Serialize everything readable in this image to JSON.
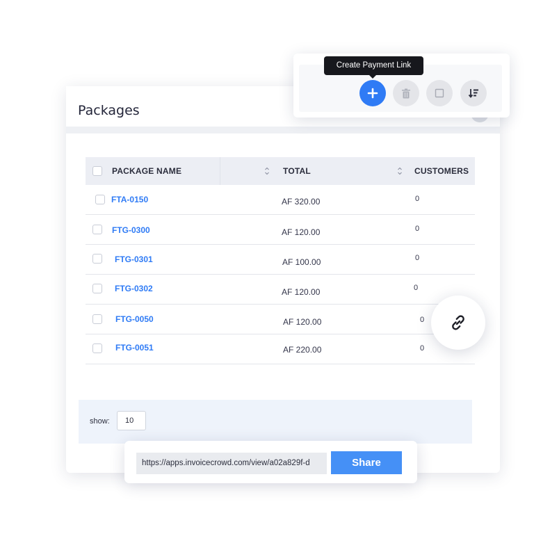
{
  "page": {
    "title": "Packages"
  },
  "toolbar": {
    "tooltip": "Create Payment Link",
    "buttons": [
      {
        "name": "add",
        "icon": "plus-icon",
        "color": "#2f7bf5"
      },
      {
        "name": "delete",
        "icon": "trash-icon"
      },
      {
        "name": "select",
        "icon": "square-icon"
      },
      {
        "name": "sort",
        "icon": "sort-icon"
      }
    ]
  },
  "table": {
    "columns": [
      "PACKAGE NAME",
      "TOTAL",
      "CUSTOMERS"
    ],
    "rows": [
      {
        "name": "FTA-0150",
        "total": "AF 320.00",
        "customers": "0"
      },
      {
        "name": "FTG-0300",
        "total": "AF 120.00",
        "customers": "0"
      },
      {
        "name": "FTG-0301",
        "total": "AF 100.00",
        "customers": "0"
      },
      {
        "name": "FTG-0302",
        "total": "AF 120.00",
        "customers": "0"
      },
      {
        "name": "FTG-0050",
        "total": "AF 120.00",
        "customers": "0"
      },
      {
        "name": "FTG-0051",
        "total": "AF 220.00",
        "customers": "0"
      }
    ]
  },
  "footer": {
    "show_label": "show:",
    "show_value": "10"
  },
  "link_button": {
    "icon": "link-icon"
  },
  "share": {
    "url": "https://apps.invoicecrowd.com/view/a02a829f-d",
    "button_label": "Share",
    "accent": "#4590f6"
  }
}
